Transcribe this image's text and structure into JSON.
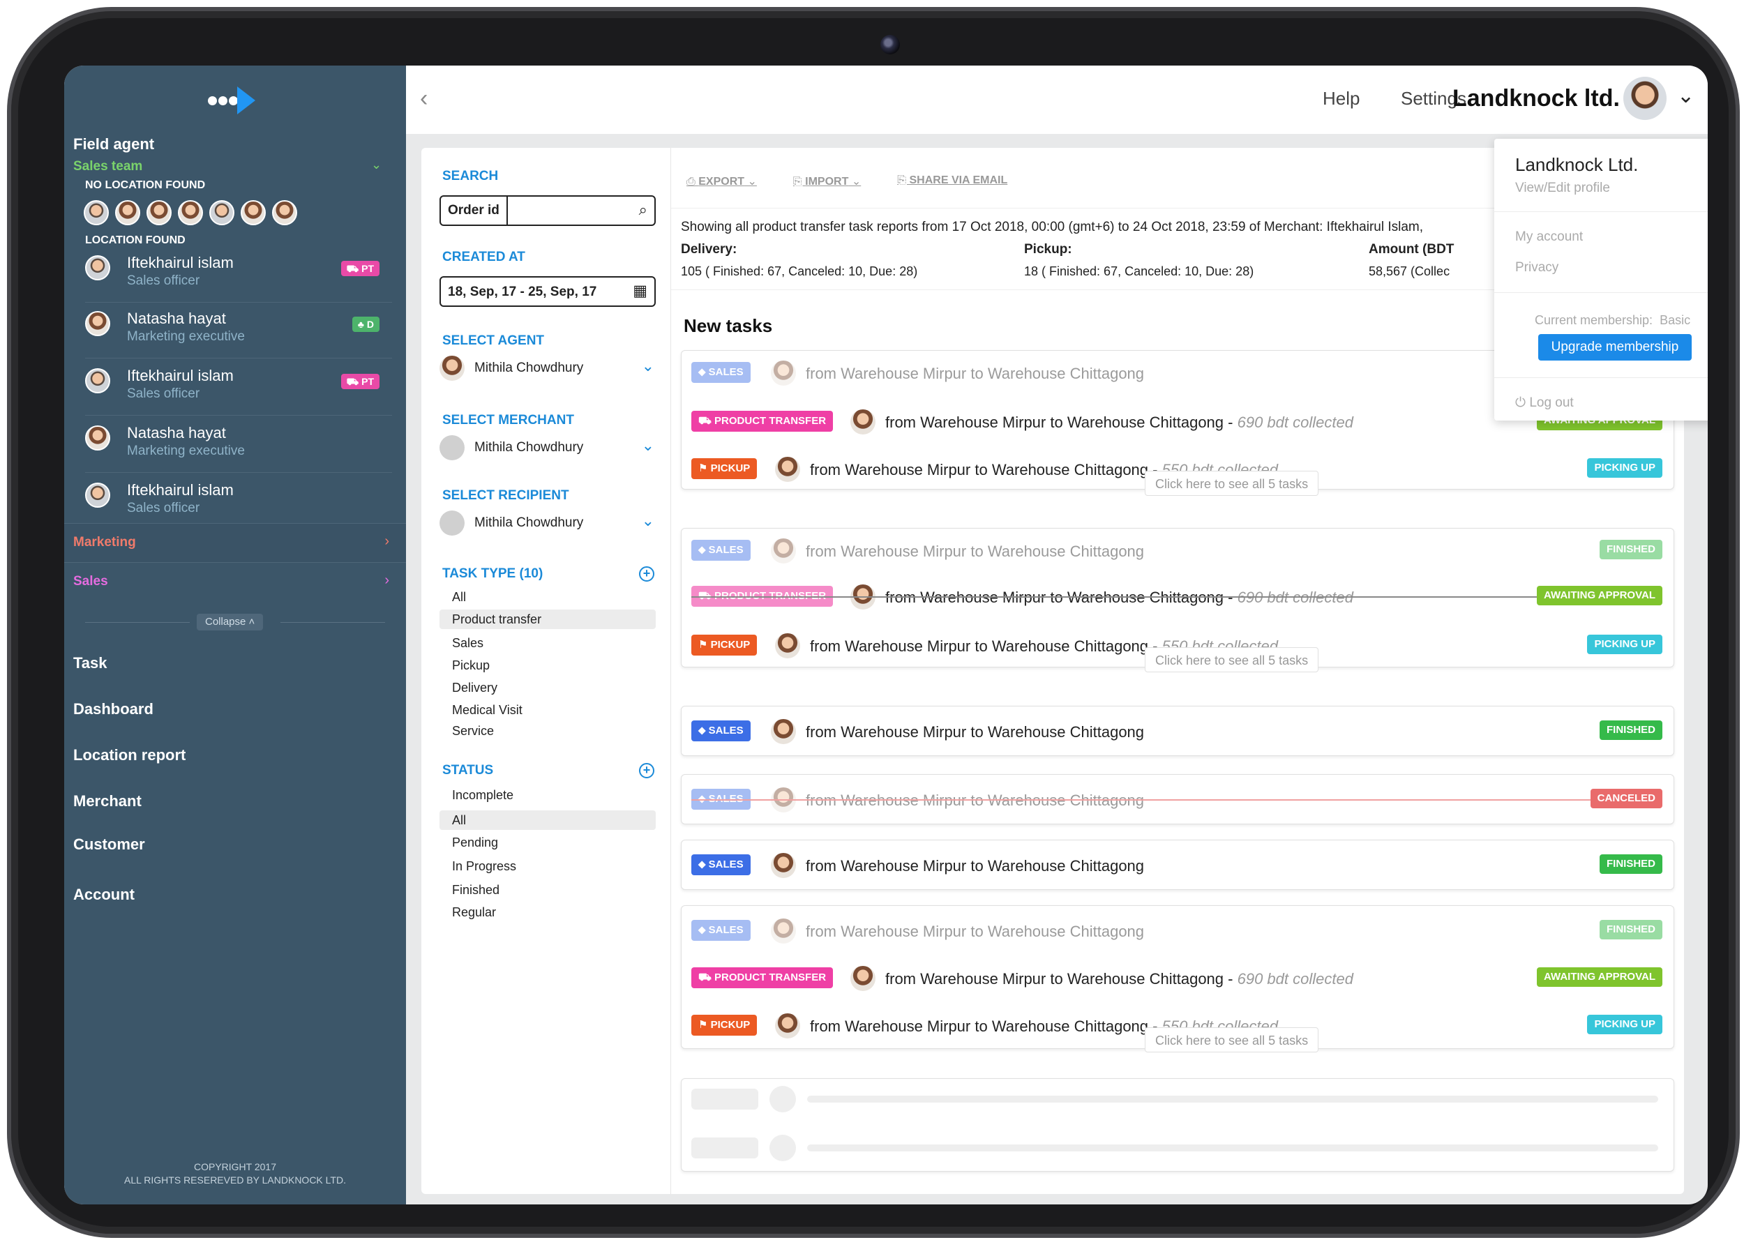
{
  "sidebar": {
    "title": "Field agent",
    "team": "Sales team",
    "no_location": "NO LOCATION FOUND",
    "location_found": "LOCATION FOUND",
    "agents": [
      {
        "name": "Iftekhairul islam",
        "role": "Sales officer",
        "tag": "PT"
      },
      {
        "name": "Natasha hayat",
        "role": "Marketing executive",
        "tag": "D"
      },
      {
        "name": "Iftekhairul islam",
        "role": "Sales officer",
        "tag": "PT"
      },
      {
        "name": "Natasha hayat",
        "role": "Marketing executive",
        "tag": ""
      },
      {
        "name": "Iftekhairul islam",
        "role": "Sales officer",
        "tag": ""
      }
    ],
    "groups": [
      {
        "label": "Marketing",
        "color": "#f07b6b"
      },
      {
        "label": "Sales",
        "color": "#e56ce0"
      }
    ],
    "collapse": "Collapse",
    "nav": [
      "Task",
      "Dashboard",
      "Location report",
      "Merchant",
      "Customer",
      "Account"
    ],
    "copyright_1": "COPYRIGHT 2017",
    "copyright_2": "ALL RIGHTS RESEREVED BY LANDKNOCK LTD."
  },
  "topbar": {
    "help": "Help",
    "settings": "Settings",
    "company": "Landknock ltd."
  },
  "filters": {
    "search_label": "SEARCH",
    "search_prefix": "Order id",
    "created_label": "CREATED AT",
    "created_value": "18, Sep, 17  -  25, Sep, 17",
    "agent_label": "SELECT AGENT",
    "agent_value": "Mithila Chowdhury",
    "merchant_label": "SELECT MERCHANT",
    "merchant_value": "Mithila Chowdhury",
    "recipient_label": "SELECT RECIPIENT",
    "recipient_value": "Mithila Chowdhury",
    "task_type_label": "TASK TYPE (10)",
    "task_types": [
      "All",
      "Product transfer",
      "Sales",
      "Pickup",
      "Delivery",
      "Medical Visit",
      "Service"
    ],
    "task_type_selected": "Product transfer",
    "status_label": "STATUS",
    "statuses": [
      "Incomplete",
      "All",
      "Pending",
      "In Progress",
      "Finished",
      "Regular"
    ],
    "status_selected": "All"
  },
  "toolbar": {
    "export": "EXPORT",
    "import": "IMPORT",
    "share": "SHARE VIA EMAIL"
  },
  "summary": {
    "line": "Showing all product transfer task reports from 17 Oct 2018, 00:00 (gmt+6) to 24 Oct 2018, 23:59 of Merchant: Iftekhairul Islam,",
    "delivery_label": "Delivery:",
    "delivery_value": "105 ( Finished: 67, Canceled: 10, Due: 28)",
    "pickup_label": "Pickup:",
    "pickup_value": "18 ( Finished: 67, Canceled: 10, Due: 28)",
    "amount_label": "Amount (BDT",
    "amount_value": "58,567 (Collec"
  },
  "tasks": {
    "heading": "New tasks",
    "route": "from Warehouse Mirpur to Warehouse Chittagong",
    "collected_690": "690 bdt collected",
    "collected_550": "550 bdt collected",
    "see_all": "Click here to see all 5 tasks",
    "tag_sales": "SALES",
    "tag_pt": "PRODUCT TRANSFER",
    "tag_pickup": "PICKUP",
    "st_finished": "FINISHED",
    "st_await": "AWAITING APPROVAL",
    "st_picking": "PICKING UP",
    "st_canceled": "CANCELED"
  },
  "menu": {
    "company": "Landknock Ltd.",
    "view_edit": "View/Edit profile",
    "my_account": "My account",
    "privacy": "Privacy",
    "membership_label": "Current membership:",
    "membership_value": "Basic",
    "upgrade": "Upgrade membership",
    "logout": "Log out"
  }
}
